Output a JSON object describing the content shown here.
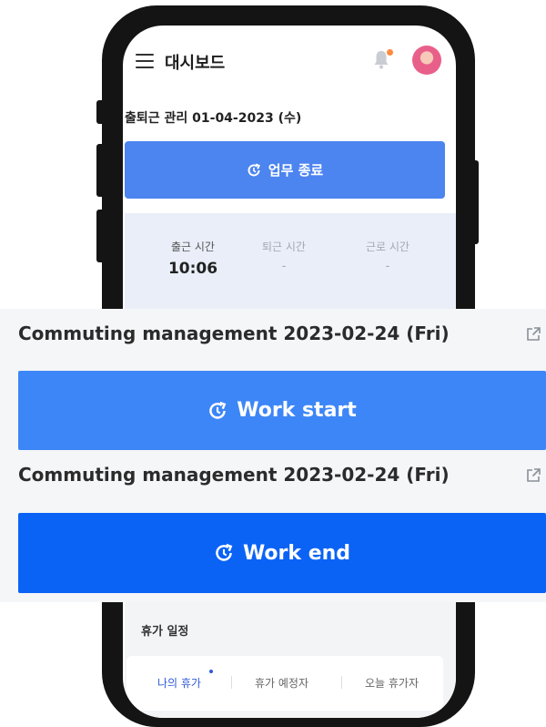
{
  "header": {
    "title": "대시보드"
  },
  "mobile": {
    "date_line": "출퇴근 관리 01-04-2023 (수)",
    "end_button_label": "업무 종료",
    "stats": [
      {
        "label": "출근 시간",
        "value": "10:06"
      },
      {
        "label": "퇴근 시간",
        "value": "-"
      },
      {
        "label": "근로 시간",
        "value": "-"
      }
    ],
    "vacation": {
      "title": "휴가 일정",
      "tabs": [
        "나의 휴가",
        "휴가 예정자",
        "오늘 휴가자"
      ]
    }
  },
  "overlay": {
    "start_card": {
      "title": "Commuting management 2023-02-24 (Fri)",
      "button_label": "Work start"
    },
    "end_card": {
      "title": "Commuting management 2023-02-24 (Fri)",
      "button_label": "Work end"
    }
  },
  "colors": {
    "primary": "#4c84f0",
    "start_button": "#3d86f7",
    "end_button": "#0b63f6",
    "notification_dot": "#ff8a3d"
  },
  "icons": [
    "menu-icon",
    "bell-icon",
    "refresh-clock-icon",
    "external-link-icon"
  ]
}
